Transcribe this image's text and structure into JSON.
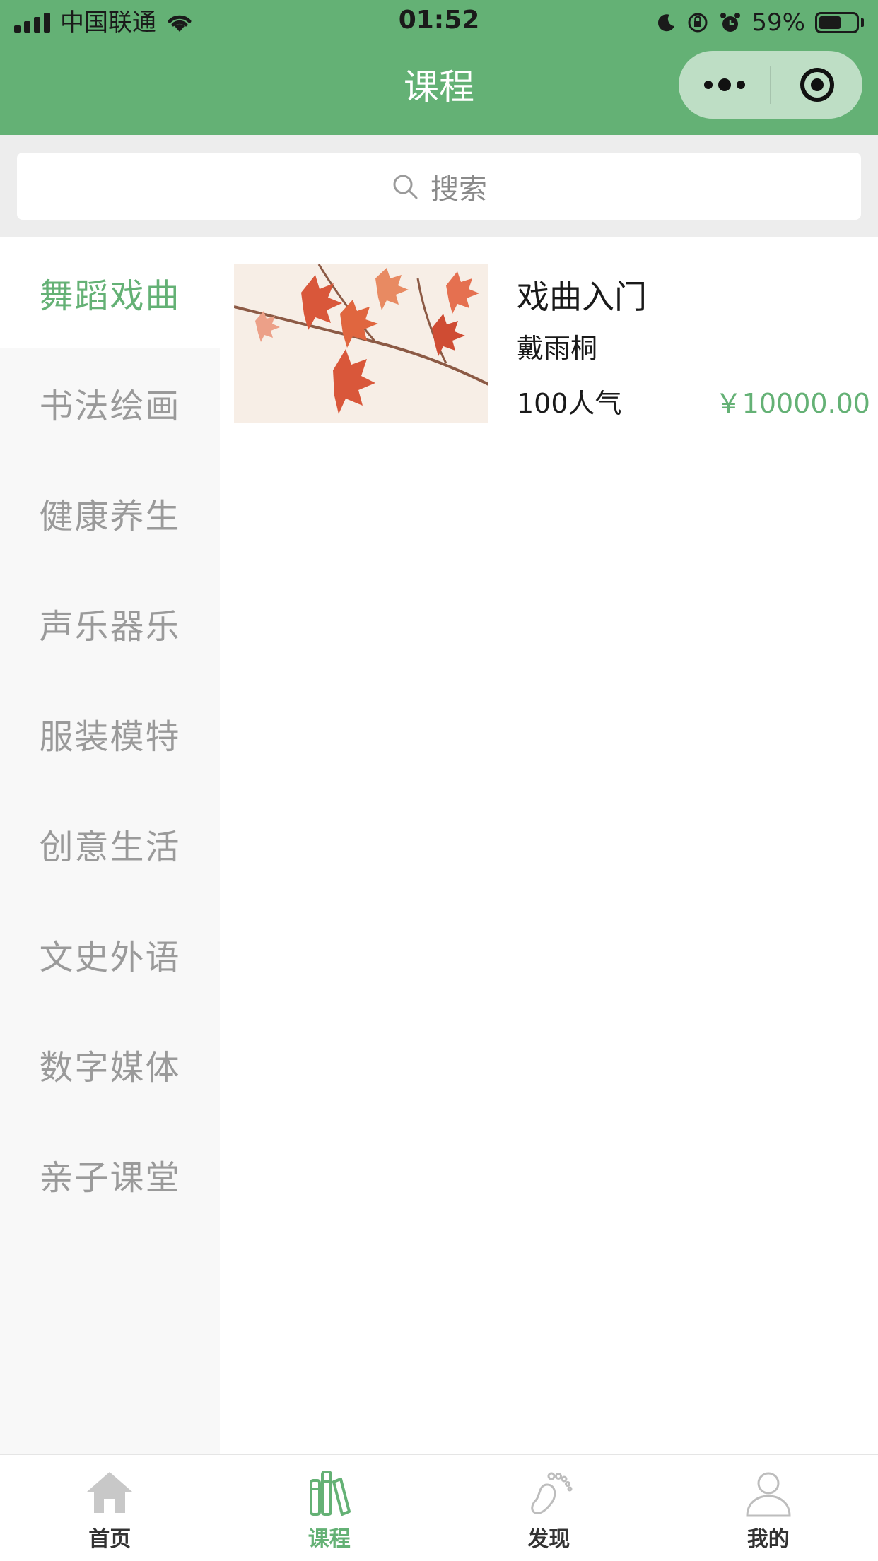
{
  "status_bar": {
    "carrier": "中国联通",
    "time": "01:52",
    "battery": "59%",
    "battery_level": 0.59
  },
  "nav": {
    "title": "课程"
  },
  "search": {
    "placeholder": "搜索"
  },
  "sidebar": {
    "items": [
      {
        "label": "舞蹈戏曲",
        "active": true
      },
      {
        "label": "书法绘画",
        "active": false
      },
      {
        "label": "健康养生",
        "active": false
      },
      {
        "label": "声乐器乐",
        "active": false
      },
      {
        "label": "服装模特",
        "active": false
      },
      {
        "label": "创意生活",
        "active": false
      },
      {
        "label": "文史外语",
        "active": false
      },
      {
        "label": "数字媒体",
        "active": false
      },
      {
        "label": "亲子课堂",
        "active": false
      }
    ]
  },
  "courses": [
    {
      "title": "戏曲入门",
      "teacher": "戴雨桐",
      "popularity": "100人气",
      "price": "￥10000.00",
      "image": "red-maple-leaves"
    }
  ],
  "tabbar": {
    "items": [
      {
        "label": "首页",
        "icon": "home-icon",
        "active": false
      },
      {
        "label": "课程",
        "icon": "books-icon",
        "active": true
      },
      {
        "label": "发现",
        "icon": "footprint-icon",
        "active": false
      },
      {
        "label": "我的",
        "icon": "user-icon",
        "active": false
      }
    ]
  },
  "colors": {
    "accent": "#64b175",
    "inactive_text": "#9a9a9a"
  }
}
